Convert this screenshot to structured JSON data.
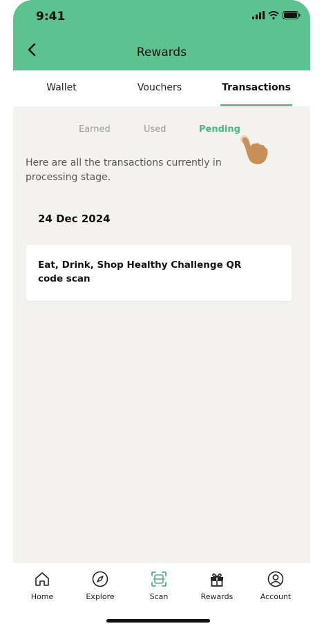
{
  "status": {
    "time": "9:41"
  },
  "header": {
    "title": "Rewards"
  },
  "tabs": [
    {
      "label": "Wallet"
    },
    {
      "label": "Vouchers"
    },
    {
      "label": "Transactions",
      "active": true
    }
  ],
  "subtabs": [
    {
      "label": "Earned"
    },
    {
      "label": "Used"
    },
    {
      "label": "Pending",
      "active": true
    }
  ],
  "description": "Here are all the transactions currently in processing stage.",
  "groups": [
    {
      "date": "24 Dec 2024",
      "items": [
        {
          "title": "Eat, Drink, Shop Healthy Challenge QR code scan"
        }
      ]
    }
  ],
  "nav": [
    {
      "label": "Home",
      "icon": "home-icon"
    },
    {
      "label": "Explore",
      "icon": "compass-icon"
    },
    {
      "label": "Scan",
      "icon": "scan-icon"
    },
    {
      "label": "Rewards",
      "icon": "gift-icon"
    },
    {
      "label": "Account",
      "icon": "user-icon"
    }
  ],
  "colors": {
    "accent": "#5cc28f",
    "active_text": "#4cb782",
    "background": "#f3f2ef"
  }
}
